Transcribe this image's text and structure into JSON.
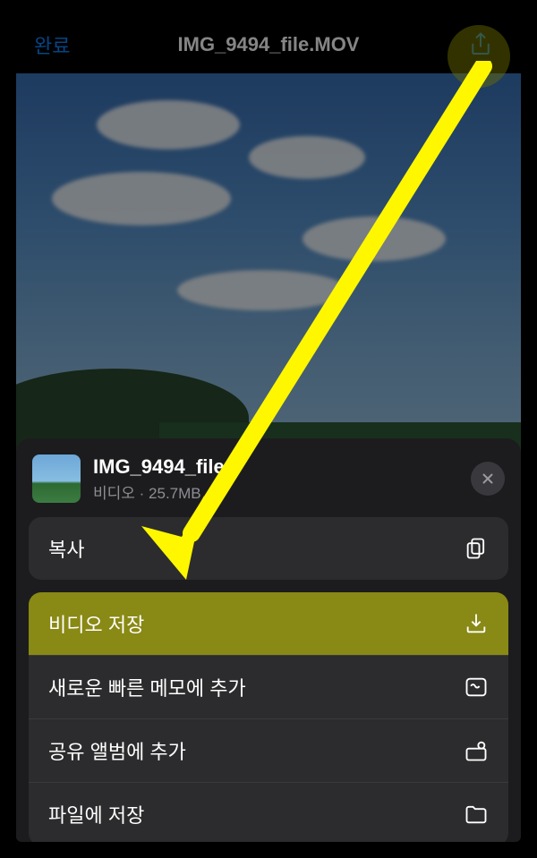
{
  "nav": {
    "done_label": "완료",
    "title": "IMG_9494_file.MOV"
  },
  "sheet": {
    "file_name": "IMG_9494_file",
    "file_type": "비디오",
    "file_size": "25.7MB"
  },
  "options": {
    "copy": "복사",
    "save_video": "비디오 저장",
    "add_quick_note": "새로운 빠른 메모에 추가",
    "add_shared_album": "공유 앨범에 추가",
    "save_to_files": "파일에 저장"
  }
}
